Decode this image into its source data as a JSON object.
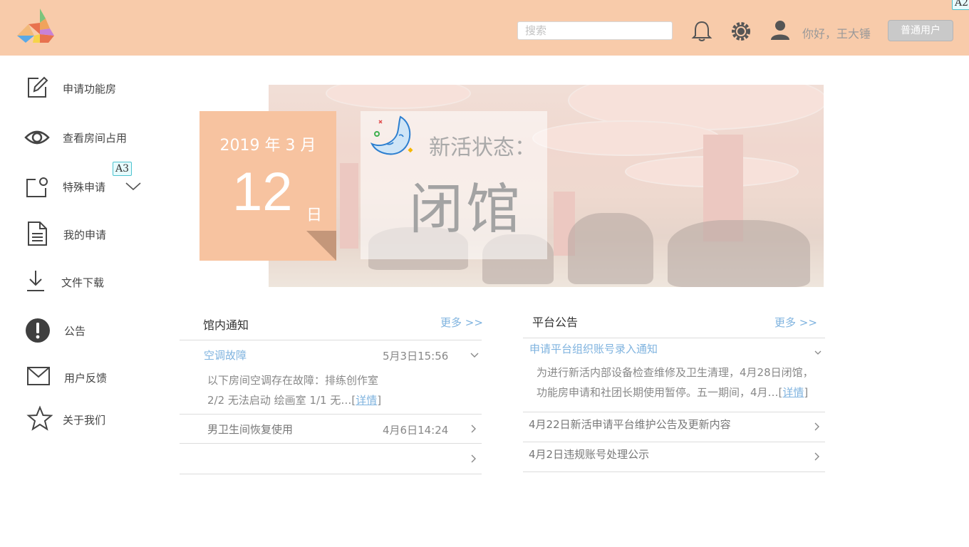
{
  "header": {
    "search_placeholder": "搜索",
    "greeting": "你好，王大锤",
    "user_role_button": "普通用户",
    "icons": [
      "logo-icon",
      "bell-icon",
      "settings-icon",
      "user-icon"
    ],
    "annotation_tag": "A2"
  },
  "sidebar": {
    "items": [
      {
        "label": "申请功能房",
        "icon": "edit-icon"
      },
      {
        "label": "查看房间占用",
        "icon": "eye-icon"
      },
      {
        "label": "特殊申请",
        "icon": "special-request-icon",
        "tag": "A3"
      },
      {
        "label": "我的申请",
        "icon": "document-icon"
      },
      {
        "label": "文件下载",
        "icon": "download-icon"
      },
      {
        "label": "公告",
        "icon": "exclamation-icon"
      },
      {
        "label": "用户反馈",
        "icon": "mail-icon"
      },
      {
        "label": "关于我们",
        "icon": "star-icon"
      }
    ]
  },
  "banner": {
    "year_month": "2019 年 3 月",
    "day": "12",
    "day_unit": "日",
    "status_label": "新活状态：",
    "status_value": "闭馆",
    "status_icon": "moon-icon"
  },
  "notices": {
    "title": "馆内通知",
    "more": "更多 >>",
    "items": [
      {
        "title": "空调故障",
        "time": "5月3日15:56",
        "desc_line1": "以下房间空调存在故障：排练创作室",
        "desc_line2": "2/2 无法启动 绘画室 1/1 无…[",
        "detail": "详情",
        "desc_end": "]"
      },
      {
        "title": "男卫生间恢复使用",
        "time": "4月6日14:24"
      },
      {
        "title": "",
        "time": ""
      }
    ]
  },
  "announcements": {
    "title": "平台公告",
    "more": "更多 >>",
    "items": [
      {
        "title": "申请平台组织账号录入通知",
        "desc_line1": "为进行新活内部设备检查维修及卫生清理，4月28日闭馆，",
        "desc_line2": "功能房申请和社团长期使用暂停。五一期间，4月…[",
        "detail": "详情",
        "desc_end": "]"
      },
      {
        "title": "4月22日新活申请平台维护公告及更新内容"
      },
      {
        "title": "4月2日违规账号处理公示"
      }
    ]
  },
  "colors": {
    "header_bg": "#f8cbaa",
    "accent_link": "#7fb3df",
    "date_card": "#f7c3a0"
  }
}
